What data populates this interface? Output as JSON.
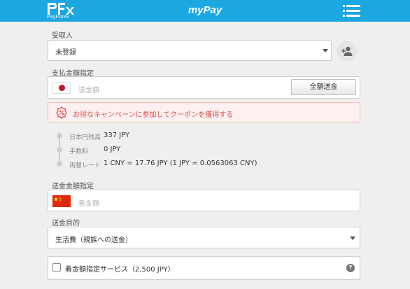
{
  "header": {
    "logo_sub": "PayForex",
    "app_title": "myPay"
  },
  "recipient": {
    "label": "受取人",
    "value": "未登録"
  },
  "send_amount": {
    "label": "支払金額指定",
    "placeholder": "送金額",
    "full_button": "全額送金"
  },
  "coupon": {
    "text": "お得なキャンペーンに参加してクーポンを獲得する"
  },
  "details": [
    {
      "key": "日本円残高",
      "value": "337 JPY"
    },
    {
      "key": "手数料",
      "value": "0 JPY"
    },
    {
      "key": "両替レート",
      "value": "1 CNY = 17.76 JPY (1 JPY = 0.0563063 CNY)"
    }
  ],
  "receive_amount": {
    "label": "送金金額指定",
    "placeholder": "着金額"
  },
  "purpose": {
    "label": "送金目的",
    "value": "生活費（親族への送金）"
  },
  "service": {
    "label": "着金額指定サービス（2,500 JPY）",
    "help_icon_text": "?"
  },
  "colors": {
    "header": "#1ba7e0",
    "coupon_text": "#d9534f",
    "jp_red": "#c8102e",
    "cn_red": "#de2910"
  }
}
